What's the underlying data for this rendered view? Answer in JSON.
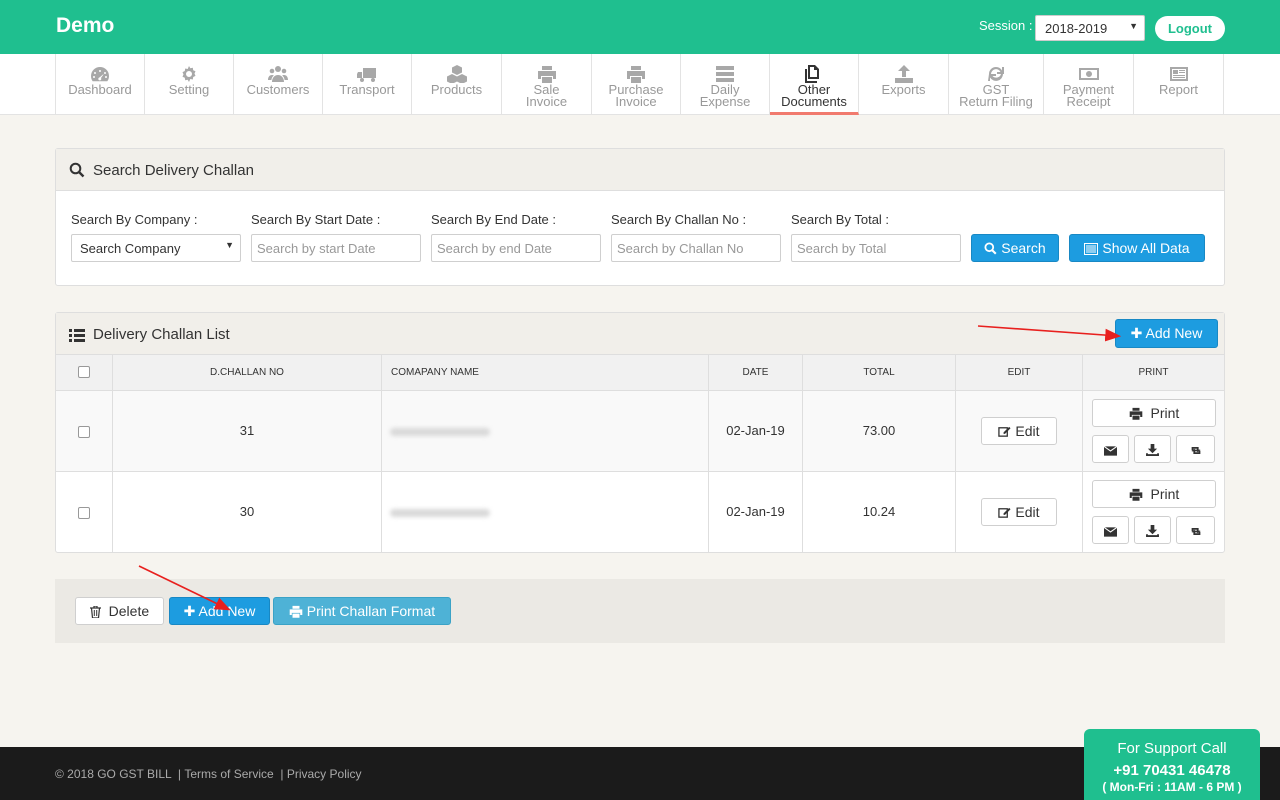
{
  "header": {
    "brand": "Demo",
    "session_label": "Session :",
    "session_value": "2018-2019",
    "logout_label": "Logout"
  },
  "nav": [
    {
      "label": "Dashboard",
      "icon": "dashboard-icon"
    },
    {
      "label": "Setting",
      "icon": "gear-icon"
    },
    {
      "label": "Customers",
      "icon": "users-icon"
    },
    {
      "label": "Transport",
      "icon": "truck-icon"
    },
    {
      "label": "Products",
      "icon": "cubes-icon"
    },
    {
      "label": "Sale\nInvoice",
      "icon": "printer-icon"
    },
    {
      "label": "Purchase\nInvoice",
      "icon": "printer-icon"
    },
    {
      "label": "Daily\nExpense",
      "icon": "server-icon"
    },
    {
      "label": "Other\nDocuments",
      "icon": "documents-icon",
      "active": true
    },
    {
      "label": "Exports",
      "icon": "upload-icon"
    },
    {
      "label": "GST\nReturn Filing",
      "icon": "refresh-icon"
    },
    {
      "label": "Payment\nReceipt",
      "icon": "money-icon"
    },
    {
      "label": "Report",
      "icon": "newspaper-icon"
    }
  ],
  "search": {
    "title": "Search Delivery Challan",
    "company_label": "Search By Company :",
    "company_value": "Search Company",
    "start_label": "Search By Start Date :",
    "start_placeholder": "Search by start Date",
    "end_label": "Search By End Date :",
    "end_placeholder": "Search by end Date",
    "challan_label": "Search By Challan No :",
    "challan_placeholder": "Search by Challan No",
    "total_label": "Search By Total :",
    "total_placeholder": "Search by Total",
    "search_button": "Search",
    "show_all_button": "Show All Data"
  },
  "list": {
    "title": "Delivery Challan List",
    "add_new": "Add New",
    "columns": [
      "D.CHALLAN NO",
      "COMAPANY NAME",
      "DATE",
      "TOTAL",
      "EDIT",
      "PRINT"
    ],
    "rows": [
      {
        "challan_no": "31",
        "company": "",
        "date": "02-Jan-19",
        "total": "73.00"
      },
      {
        "challan_no": "30",
        "company": "",
        "date": "02-Jan-19",
        "total": "10.24"
      }
    ],
    "edit_label": "Edit",
    "print_label": "Print"
  },
  "actions": {
    "delete": "Delete",
    "add_new": "Add New",
    "print_format": "Print Challan Format"
  },
  "footer": {
    "copyright": "© 2018 GO GST BILL",
    "terms": "Terms of Service",
    "privacy": "Privacy Policy"
  },
  "support": {
    "title": "For Support Call",
    "phone": "+91 70431 46478",
    "hours": "( Mon-Fri : 11AM - 6 PM )"
  },
  "colors": {
    "brand": "#1fbf8f",
    "primary_button": "#1d9ce0",
    "active_tab_underline": "#f17a6e",
    "annotation_arrow": "#e8201e"
  }
}
